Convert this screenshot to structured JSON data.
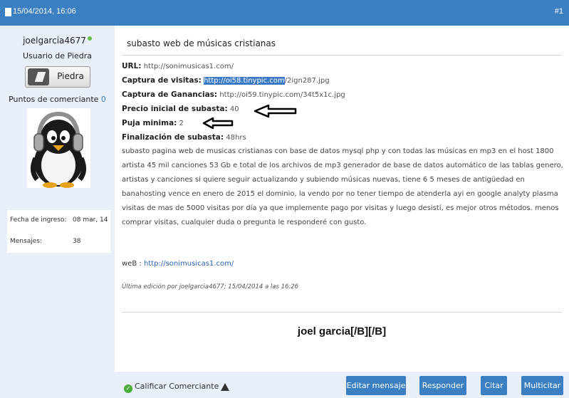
{
  "header": {
    "datetime": "15/04/2014,   16:06",
    "post_number": "#1"
  },
  "user": {
    "username": "joelgarcia4677",
    "rank_title": "Usuario de Piedra",
    "rank_badge": "Piedra",
    "merchant_points_label": "Puntos de comerciante",
    "merchant_points": "0",
    "join_date_label": "Fecha de ingreso:",
    "join_date": "08 mar, 14",
    "messages_label": "Mensajes:",
    "messages": "38"
  },
  "post": {
    "title": "subasto web de músicas cristianas",
    "url_label": "URL:",
    "url": "http://sonimusicas1.com/",
    "visits_label": "Captura de visitas:",
    "visits_link_selected": "http://oi58.tinypic.com",
    "visits_link_rest": "/2ign287.jpg",
    "earnings_label": "Captura de Ganancias:",
    "earnings_link": "http://oi59.tinypic.com/34t5x1c.jpg",
    "start_price_label": "Precio inicial de subasta:",
    "start_price": "40",
    "min_bid_label": "Puja minima:",
    "min_bid": "2",
    "end_label": "Finalización de subasta:",
    "end_value": "48hrs",
    "description": "subasto pagina web de musicas cristianas con base de datos mysql php y con todas las músicas en mp3 en el host 1800 artista 45 mil canciones 53 Gb e total de los archivos de mp3 generador de base de datos automático de las tablas genero, artistas y canciones si quiere seguir actualizando y subiendo músicas nuevas, tiene 6 5 meses de antigüedad en banahosting vence en enero de 2015 el dominio, la vendo por no tener tiempo de atenderla ayi en google analyty plasma visitas de mas de 5000 visitas por día ya que implemente pago por visitas y luego desistí, es mejor otros métodos. menos comprar visitas, cualquier duda o pregunta le responderé con gusto.",
    "web_label": "weB :",
    "web_link": "http://sonimusicas1.com/",
    "edit_note": "Última edición por joelgarcia4677; 15/04/2014 a las 16:26",
    "signature": "joel garcia[/B][/B]"
  },
  "footer": {
    "rate_label": "Calificar Comerciante",
    "edit_button": "Editar mensaje",
    "reply_button": "Responder",
    "quote_button": "Citar",
    "multiquote_button": "Multicitar"
  },
  "colors": {
    "header_bar": "#3a7fc1",
    "sidebar_bg": "#e8eff7",
    "button": "#3a7fc1",
    "link": "#2e63b6"
  },
  "icons": [
    "document-icon",
    "online-status-icon",
    "rank-badge-icon",
    "penguin-avatar",
    "arrow-left-icon",
    "checkmark-icon",
    "warning-icon"
  ]
}
